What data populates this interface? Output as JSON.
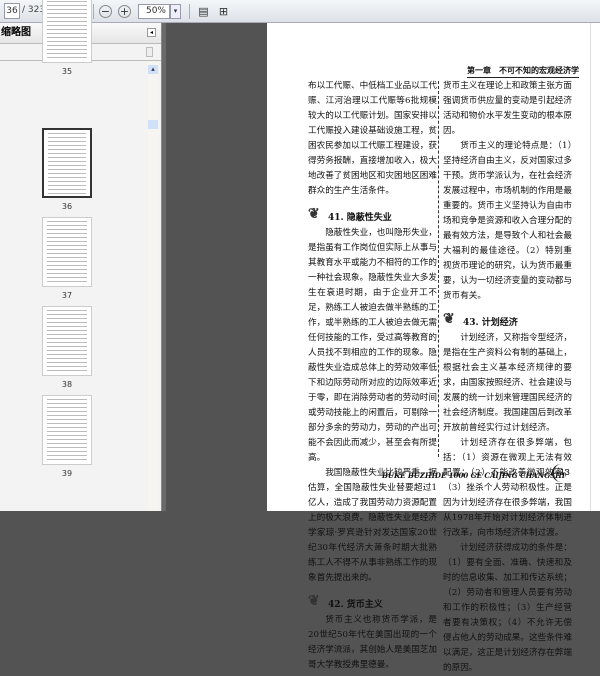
{
  "toolbar": {
    "page_current": "36",
    "page_total": "/ 323",
    "zoom": "50%"
  },
  "panel": {
    "title": "缩略图",
    "thumbnails": [
      {
        "label": "35"
      },
      {
        "label": "36",
        "selected": true
      },
      {
        "label": "37"
      },
      {
        "label": "38"
      },
      {
        "label": "39"
      }
    ]
  },
  "page": {
    "running_head": "第一章　不可不知的宏观经济学",
    "left": [
      {
        "type": "p",
        "cont": true,
        "text": "布以工代赈、中低档工业品以工代赈、江河治理以工代赈等6批规模较大的以工代赈计划。国家安排以工代赈投入建设基础设施工程，贫困农民参加以工代赈工程建设，获得劳务报酬，直接增加收入，极大地改善了贫困地区和灾困地区困难群众的生产生活条件。"
      },
      {
        "type": "h",
        "text": "41. 隐蔽性失业"
      },
      {
        "type": "p",
        "text": "隐蔽性失业，也叫隐形失业，是指虽有工作岗位但实际上从事与其教育水平或能力不相符的工作的一种社会现象。隐蔽性失业大多发生在衰退时期，由于企业开工不足，熟练工人被迫去做半熟练的工作，或半熟练的工人被迫去做无需任何技能的工作，受过高等教育的人员找不到相应的工作的现象。隐蔽性失业造成总体上的劳动效率低下和边际劳动所对应的边际效率近于零，即在消除劳动者的劳动时间或劳动技能上的闲置后，可剔除一部分多余的劳动力，劳动的产出可能不会因此而减少，甚至会有所提高。"
      },
      {
        "type": "p",
        "text": "我国隐蔽性失业比较严重，据估算，全国隐蔽性失业替要超过1亿人，造成了我国劳动力资源配置上的极大浪费。隐蔽性失业是经济学家琼·罗宾逊针对发达国家20世纪30年代经济大萧条时期大批熟练工人不得不从事非熟练工作的现象首先提出来的。"
      },
      {
        "type": "h",
        "text": "42. 货币主义"
      },
      {
        "type": "p",
        "text": "货币主义也称货币学派，是20世纪50年代在美国出现的一个经济学流派，其创始人是美国芝加哥大学教授弗里德曼。"
      }
    ],
    "right": [
      {
        "type": "p",
        "cont": true,
        "text": "货币主义在理论上和政策主张方面强调货币供应量的变动是引起经济活动和物价水平发生变动的根本原因。"
      },
      {
        "type": "p",
        "text": "货币主义的理论特点是：（1）坚持经济自由主义，反对国家过多干预。货币学派认为，在社会经济发展过程中，市场机制的作用是最重要的。货币主义坚持认为自由市场和竞争是资源和收入合理分配的最有效方法，是导致个人和社会最大福利的最佳途径。（2）特别重视货币理论的研究，认为货币最重要，认为一切经济变量的变动都与货币有关。"
      },
      {
        "type": "h",
        "text": "43. 计划经济"
      },
      {
        "type": "p",
        "text": "计划经济，又称指令型经济，是指在生产资料公有制的基础上，根据社会主义基本经济规律的要求，由国家按照经济、社会建设与发展的统一计划来管理国民经济的社会经济制度。我国建国后到改革开放前曾经实行过计划经济。"
      },
      {
        "type": "p",
        "text": "计划经济存在很多弊端，包括：（1）资源在微观上无法有效配置；（2）不能改善微观效率；（3）挫杀个人劳动积极性。正是因为计划经济存在很多弊端，我国从1978年开始对计划经济体制进行改革，向市场经济体制过渡。"
      },
      {
        "type": "p",
        "text": "计划经济获得成功的条件是：（1）要有全面、准确、快速和及时的信息收集、加工和传达系统；（2）劳动者和管理人员要有劳动和工作的积极性；（3）生产经营者要有决策权；（4）不允许无偿侵占他人的劳动成果。这些条件难以满足，这正是计划经济存在弊端的原因。"
      }
    ],
    "footer": "BUKE BUZHIDE 1000 GE CAIJING CHANGSHI",
    "page_number": "13"
  }
}
